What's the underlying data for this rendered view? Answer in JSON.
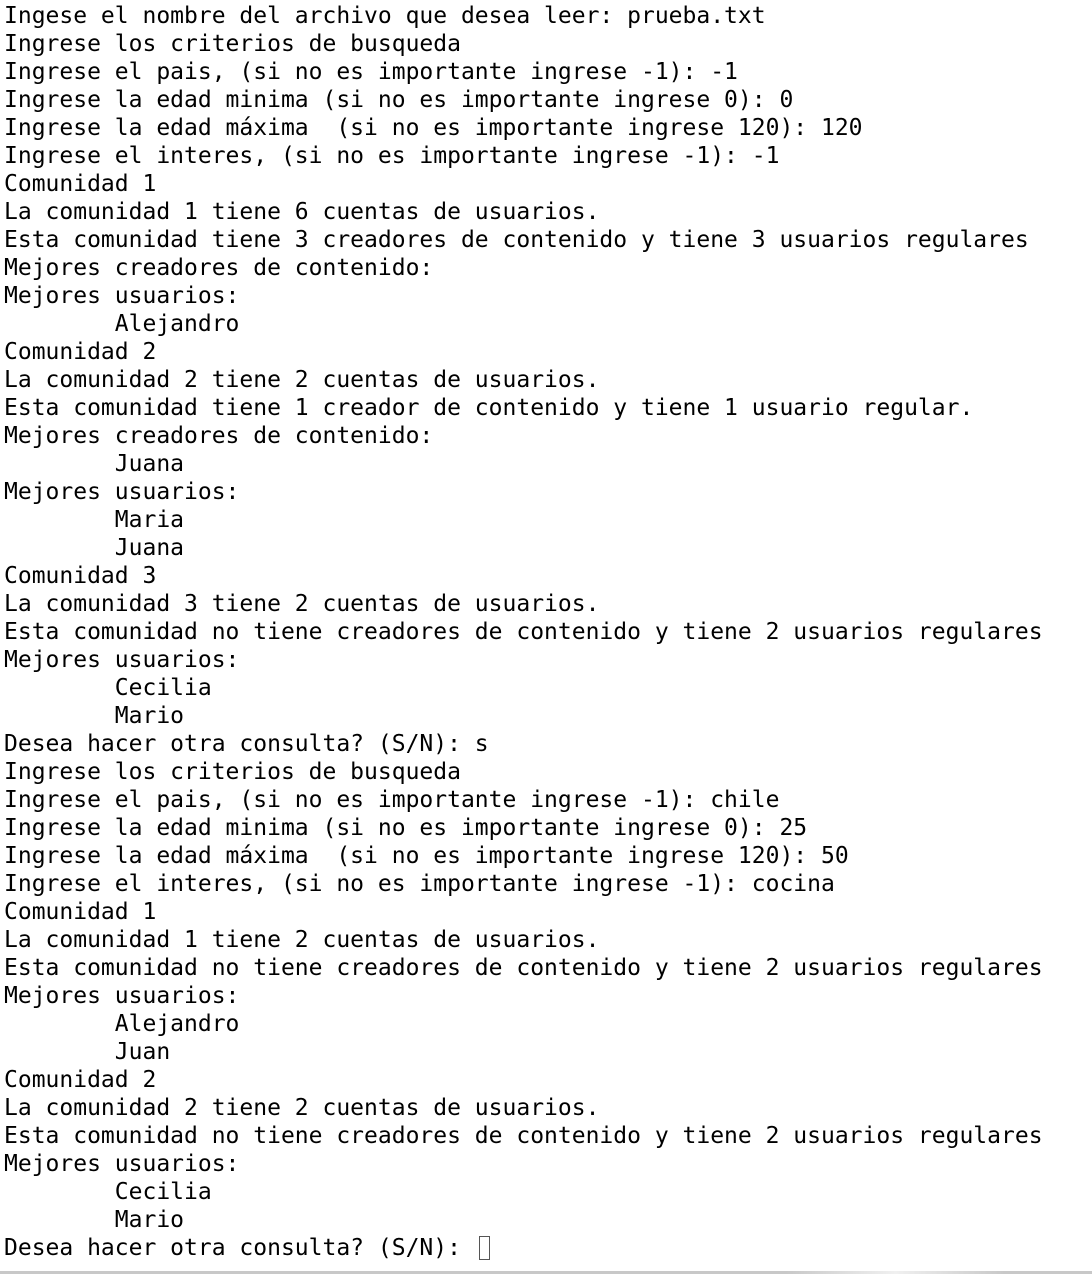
{
  "terminal": {
    "lines": [
      "Ingese el nombre del archivo que desea leer: prueba.txt",
      "Ingrese los criterios de busqueda",
      "Ingrese el pais, (si no es importante ingrese -1): -1",
      "Ingrese la edad minima (si no es importante ingrese 0): 0",
      "Ingrese la edad máxima  (si no es importante ingrese 120): 120",
      "Ingrese el interes, (si no es importante ingrese -1): -1",
      "Comunidad 1",
      "La comunidad 1 tiene 6 cuentas de usuarios.",
      "Esta comunidad tiene 3 creadores de contenido y tiene 3 usuarios regulares",
      "Mejores creadores de contenido:",
      "Mejores usuarios:",
      "        Alejandro",
      "Comunidad 2",
      "La comunidad 2 tiene 2 cuentas de usuarios.",
      "Esta comunidad tiene 1 creador de contenido y tiene 1 usuario regular.",
      "Mejores creadores de contenido:",
      "        Juana",
      "Mejores usuarios:",
      "        Maria",
      "        Juana",
      "Comunidad 3",
      "La comunidad 3 tiene 2 cuentas de usuarios.",
      "Esta comunidad no tiene creadores de contenido y tiene 2 usuarios regulares",
      "Mejores usuarios:",
      "        Cecilia",
      "        Mario",
      "Desea hacer otra consulta? (S/N): s",
      "Ingrese los criterios de busqueda",
      "Ingrese el pais, (si no es importante ingrese -1): chile",
      "Ingrese la edad minima (si no es importante ingrese 0): 25",
      "Ingrese la edad máxima  (si no es importante ingrese 120): 50",
      "Ingrese el interes, (si no es importante ingrese -1): cocina",
      "Comunidad 1",
      "La comunidad 1 tiene 2 cuentas de usuarios.",
      "Esta comunidad no tiene creadores de contenido y tiene 2 usuarios regulares",
      "Mejores usuarios:",
      "        Alejandro",
      "        Juan",
      "Comunidad 2",
      "La comunidad 2 tiene 2 cuentas de usuarios.",
      "Esta comunidad no tiene creadores de contenido y tiene 2 usuarios regulares",
      "Mejores usuarios:",
      "        Cecilia",
      "        Mario"
    ],
    "prompt": "Desea hacer otra consulta? (S/N): ",
    "colors": {
      "background": "#ffffff",
      "text": "#000000",
      "cursor": "#555555"
    }
  }
}
